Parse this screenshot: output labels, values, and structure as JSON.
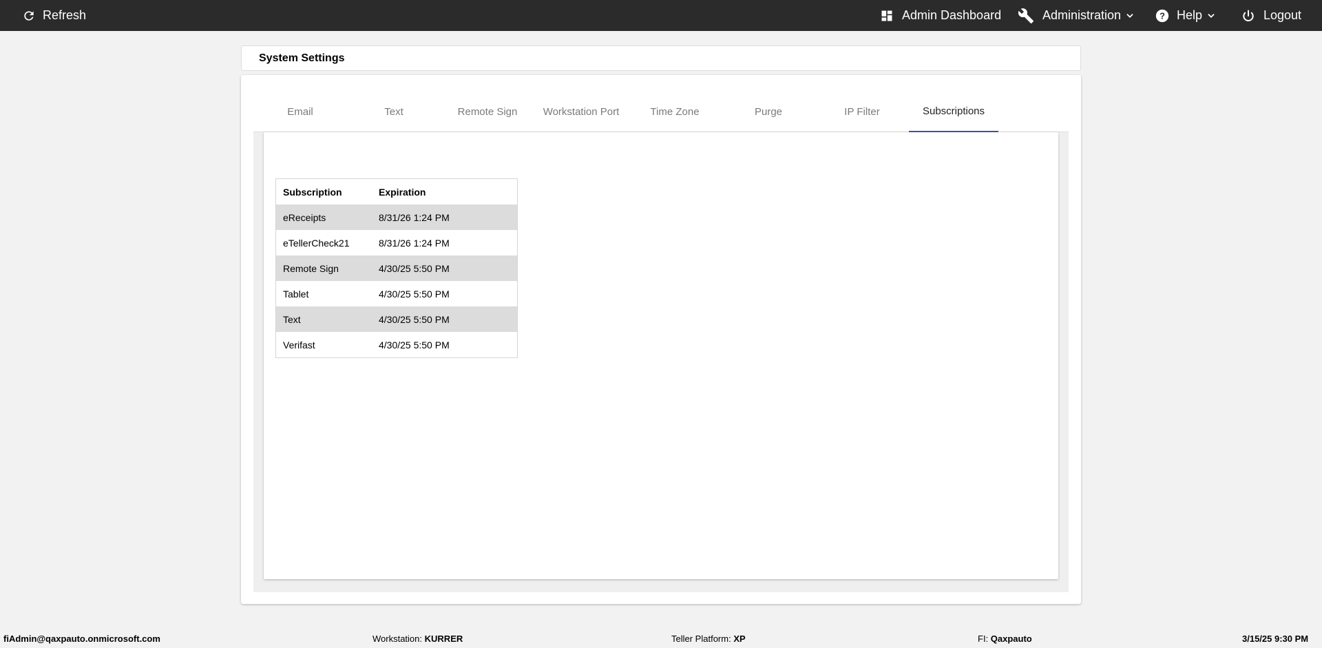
{
  "topbar": {
    "refresh_label": "Refresh",
    "admin_dashboard_label": "Admin Dashboard",
    "administration_label": "Administration",
    "help_label": "Help",
    "logout_label": "Logout"
  },
  "page": {
    "title": "System Settings"
  },
  "tabs": [
    {
      "label": "Email"
    },
    {
      "label": "Text"
    },
    {
      "label": "Remote Sign"
    },
    {
      "label": "Workstation Port"
    },
    {
      "label": "Time Zone"
    },
    {
      "label": "Purge"
    },
    {
      "label": "IP Filter"
    },
    {
      "label": "Subscriptions",
      "active": true
    }
  ],
  "subscriptions": {
    "headers": {
      "subscription": "Subscription",
      "expiration": "Expiration"
    },
    "rows": [
      {
        "subscription": "eReceipts",
        "expiration": "8/31/26 1:24 PM"
      },
      {
        "subscription": "eTellerCheck21",
        "expiration": "8/31/26 1:24 PM"
      },
      {
        "subscription": "Remote Sign",
        "expiration": "4/30/25 5:50 PM"
      },
      {
        "subscription": "Tablet",
        "expiration": "4/30/25 5:50 PM"
      },
      {
        "subscription": "Text",
        "expiration": "4/30/25 5:50 PM"
      },
      {
        "subscription": "Verifast",
        "expiration": "4/30/25 5:50 PM"
      }
    ]
  },
  "footer": {
    "user": "fiAdmin@qaxpauto.onmicrosoft.com",
    "workstation_label": "Workstation:",
    "workstation_value": "KURRER",
    "platform_label": "Teller Platform:",
    "platform_value": "XP",
    "fi_label": "FI:",
    "fi_value": "Qaxpauto",
    "datetime": "3/15/25 9:30 PM"
  },
  "colors": {
    "topbar_bg": "#2b2b2b",
    "active_tab_underline": "#3f51b5",
    "shaded_row": "#dcdcdc"
  }
}
